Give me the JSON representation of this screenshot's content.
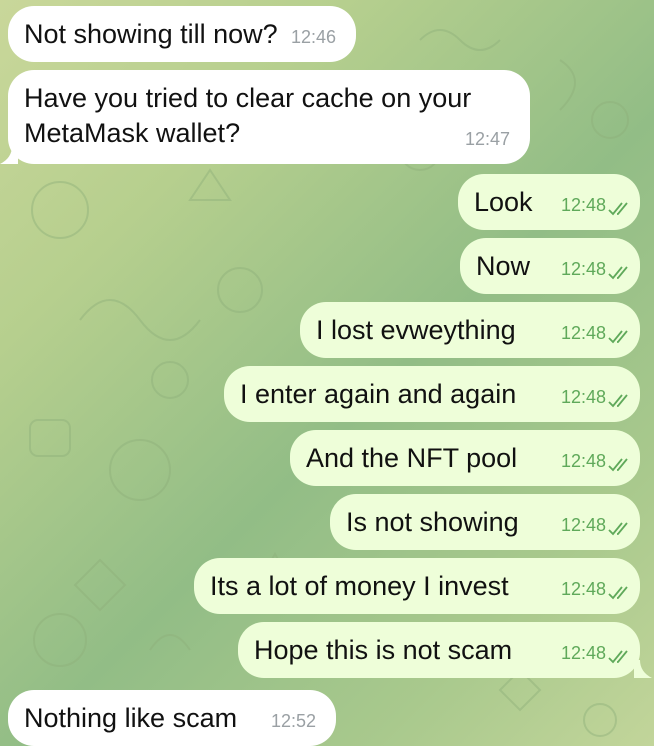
{
  "messages": [
    {
      "text": "Not showing till now?",
      "time": "12:46",
      "dir": "in"
    },
    {
      "text": "Have you tried to clear cache on your MetaMask wallet?",
      "line1": "Have you tried to clear cache on your",
      "line2": "MetaMask wallet?",
      "time": "12:47",
      "dir": "in"
    },
    {
      "text": "Look",
      "time": "12:48",
      "dir": "out"
    },
    {
      "text": "Now",
      "time": "12:48",
      "dir": "out"
    },
    {
      "text": "I lost evweything",
      "time": "12:48",
      "dir": "out"
    },
    {
      "text": "I enter again and again",
      "time": "12:48",
      "dir": "out"
    },
    {
      "text": "And the NFT pool",
      "time": "12:48",
      "dir": "out"
    },
    {
      "text": "Is not showing",
      "time": "12:48",
      "dir": "out"
    },
    {
      "text": "Its a lot of money I invest",
      "time": "12:48",
      "dir": "out"
    },
    {
      "text": "Hope this is not scam",
      "time": "12:48",
      "dir": "out"
    },
    {
      "text": "Nothing like scam",
      "time": "12:52",
      "dir": "in"
    }
  ],
  "colors": {
    "incoming_bubble": "#ffffff",
    "outgoing_bubble": "#eefed9",
    "outgoing_time": "#5fa95a",
    "incoming_time": "#9aa0a4",
    "read_check": "#5fa95a"
  },
  "icons": {
    "read_status": "double-check-icon"
  }
}
